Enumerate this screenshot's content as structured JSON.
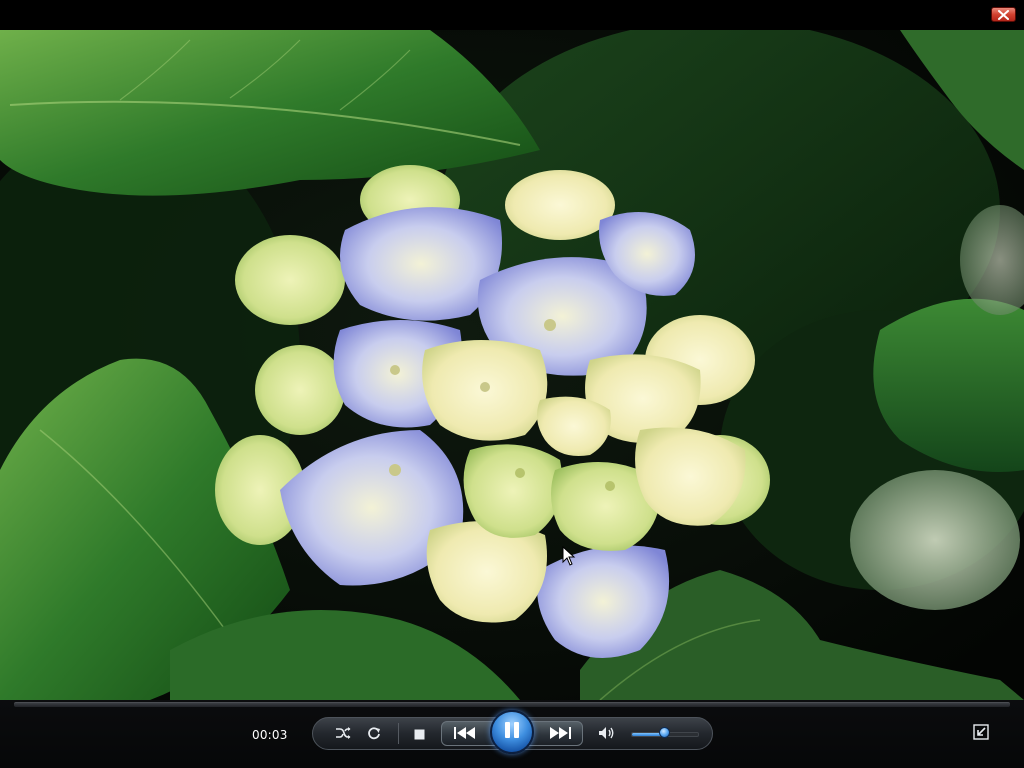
{
  "window": {
    "close_icon": "close-icon"
  },
  "video": {
    "description_icon": "video-frame"
  },
  "controls": {
    "time_elapsed": "00:03",
    "seek_progress": 0.0,
    "icons": {
      "shuffle": "shuffle-icon",
      "repeat": "repeat-icon",
      "stop": "stop-icon",
      "previous": "previous-icon",
      "pause": "pause-icon",
      "next": "next-icon",
      "mute": "speaker-icon",
      "switch_to_library": "switch-to-library-icon"
    },
    "volume_level": 0.5
  },
  "colors": {
    "accent": "#3f8fe0",
    "close_button": "#d2412f",
    "background": "#000000"
  }
}
